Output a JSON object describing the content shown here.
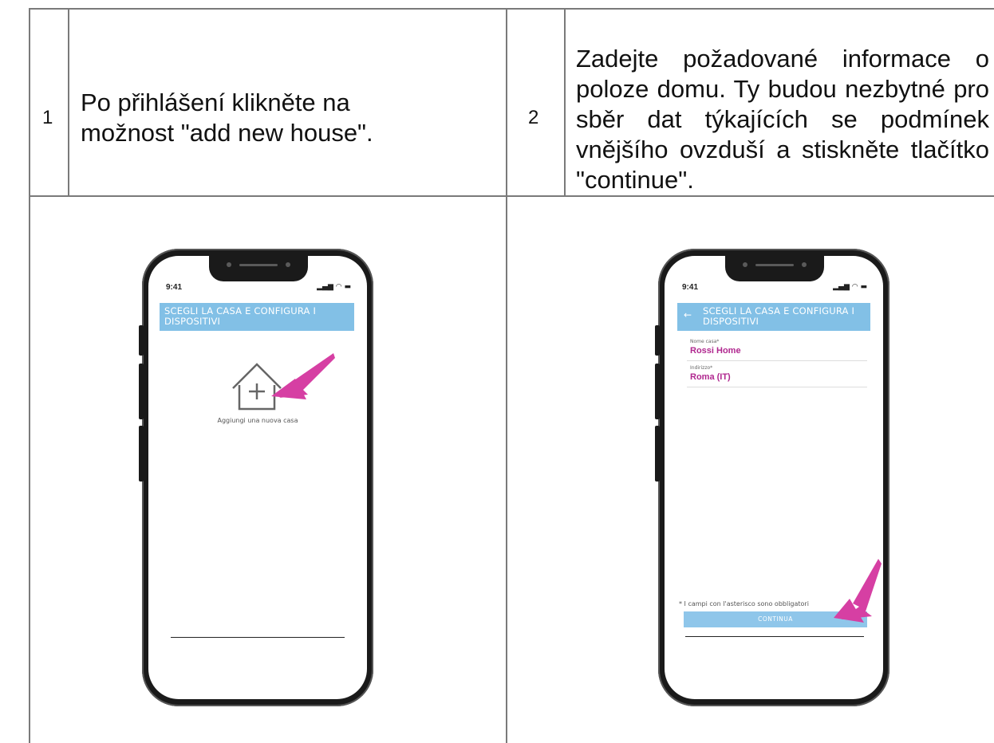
{
  "step1": {
    "number": "1",
    "text": "Po přihlášení klikněte na možnost \"add new house\".",
    "phone": {
      "time": "9:41",
      "appbar_title": "SCEGLI LA CASA E CONFIGURA I DISPOSITIVI",
      "add_house_caption": "Aggiungi una nuova casa"
    }
  },
  "step2": {
    "number": "2",
    "text": "Zadejte požadované informace o poloze domu. Ty budou nezbytné pro sběr dat týkajících se podmínek vnějšího ovzduší a stiskněte tlačítko \"continue\".",
    "phone": {
      "time": "9:41",
      "appbar_title": "SCEGLI LA CASA E CONFIGURA I DISPOSITIVI",
      "back_icon": "←",
      "fields": [
        {
          "label": "Nome casa*",
          "value": "Rossi Home"
        },
        {
          "label": "Indirizzo*",
          "value": "Roma (IT)"
        }
      ],
      "required_note": "* I campi con l'asterisco sono obbligatori",
      "continue_label": "CONTINUA"
    }
  },
  "colors": {
    "appbar": "#82c0e6",
    "accent_arrow": "#d63fa3",
    "field_value": "#b0278f",
    "border": "#7a7a7a"
  }
}
